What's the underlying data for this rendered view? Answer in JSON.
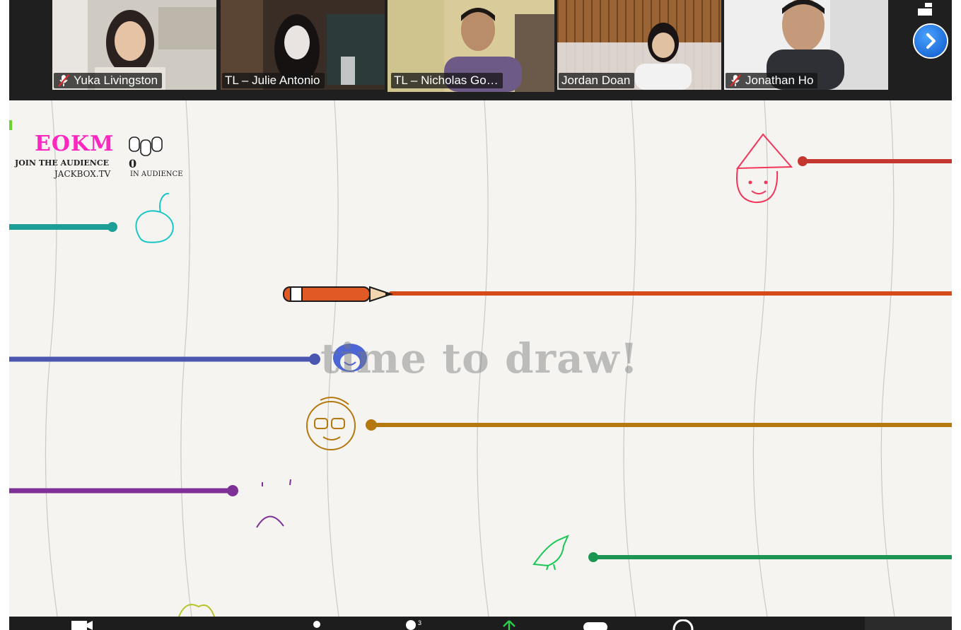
{
  "participants": [
    {
      "name": "Yuka Livingston",
      "muted": true,
      "active": false
    },
    {
      "name": "TL – Julie Antonio",
      "muted": false,
      "active": false
    },
    {
      "name": "TL – Nicholas Go…",
      "muted": false,
      "active": true
    },
    {
      "name": "Jordan Doan",
      "muted": false,
      "active": false
    },
    {
      "name": "Jonathan Ho",
      "muted": true,
      "active": false
    }
  ],
  "gallery": {
    "next_page_icon": "chevron-right-icon",
    "view_icon": "gallery-view-icon"
  },
  "game": {
    "logo": "EOKM",
    "join_text": "JOIN THE AUDIENCE",
    "site": "JACKBOX.TV",
    "audience_count": "0",
    "audience_label": "IN AUDIENCE",
    "prompt": "time to draw!",
    "player_line_colors": [
      "#1a9e95",
      "#c4372f",
      "#d64a1a",
      "#4a56b0",
      "#b5780e",
      "#7d3197",
      "#1a9552"
    ]
  }
}
